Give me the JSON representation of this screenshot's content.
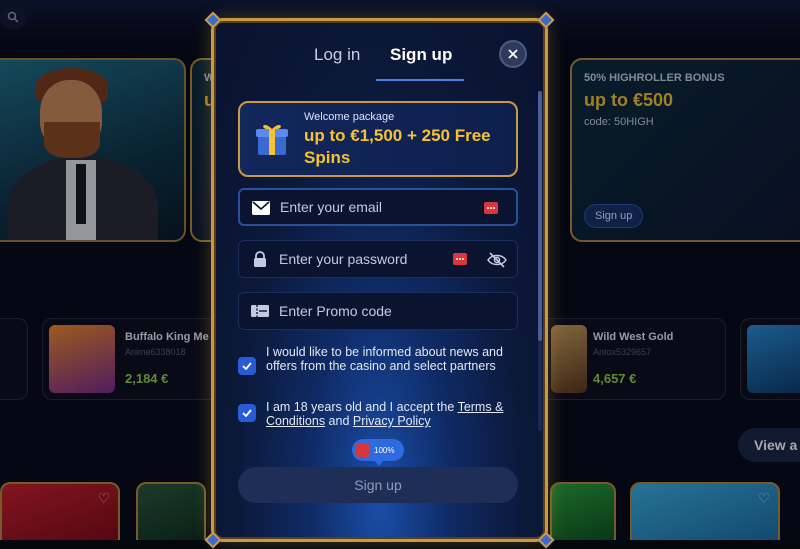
{
  "background": {
    "promo_right": {
      "title": "50% HIGHROLLER BONUS",
      "amount": "up to €500",
      "code": "code: 50HIGH",
      "button": "Sign up"
    },
    "promo_left_partial": {
      "title": "W",
      "amount": "u"
    },
    "games": [
      {
        "name": "Buffalo King Me",
        "user": "Anime6338018",
        "amount": "2,184 €"
      },
      {
        "name": "Wild West Gold",
        "user": "Antox5329657",
        "amount": "4,657 €"
      }
    ],
    "view_all": "View a"
  },
  "modal": {
    "tabs": [
      "Log in",
      "Sign up"
    ],
    "active_tab": "Sign up",
    "close_icon": "close-icon",
    "welcome": {
      "label": "Welcome package",
      "amount": "up to €1,500 + 250 Free Spins"
    },
    "fields": {
      "email_placeholder": "Enter your email",
      "password_placeholder": "Enter your password",
      "promo_placeholder": "Enter Promo code"
    },
    "consents": {
      "news": "I would like to be informed about news and offers from the casino and select partners",
      "age_prefix": "I am 18 years old and I accept the ",
      "terms_link": "Terms & Conditions",
      "and": " and ",
      "privacy_link": "Privacy Policy"
    },
    "progress_badge": "100%",
    "submit": "Sign up"
  },
  "colors": {
    "accent_gold": "#c99a45",
    "bonus_yellow": "#f5c233",
    "accent_blue": "#2a5bd6",
    "win_green": "#8fd14f"
  }
}
